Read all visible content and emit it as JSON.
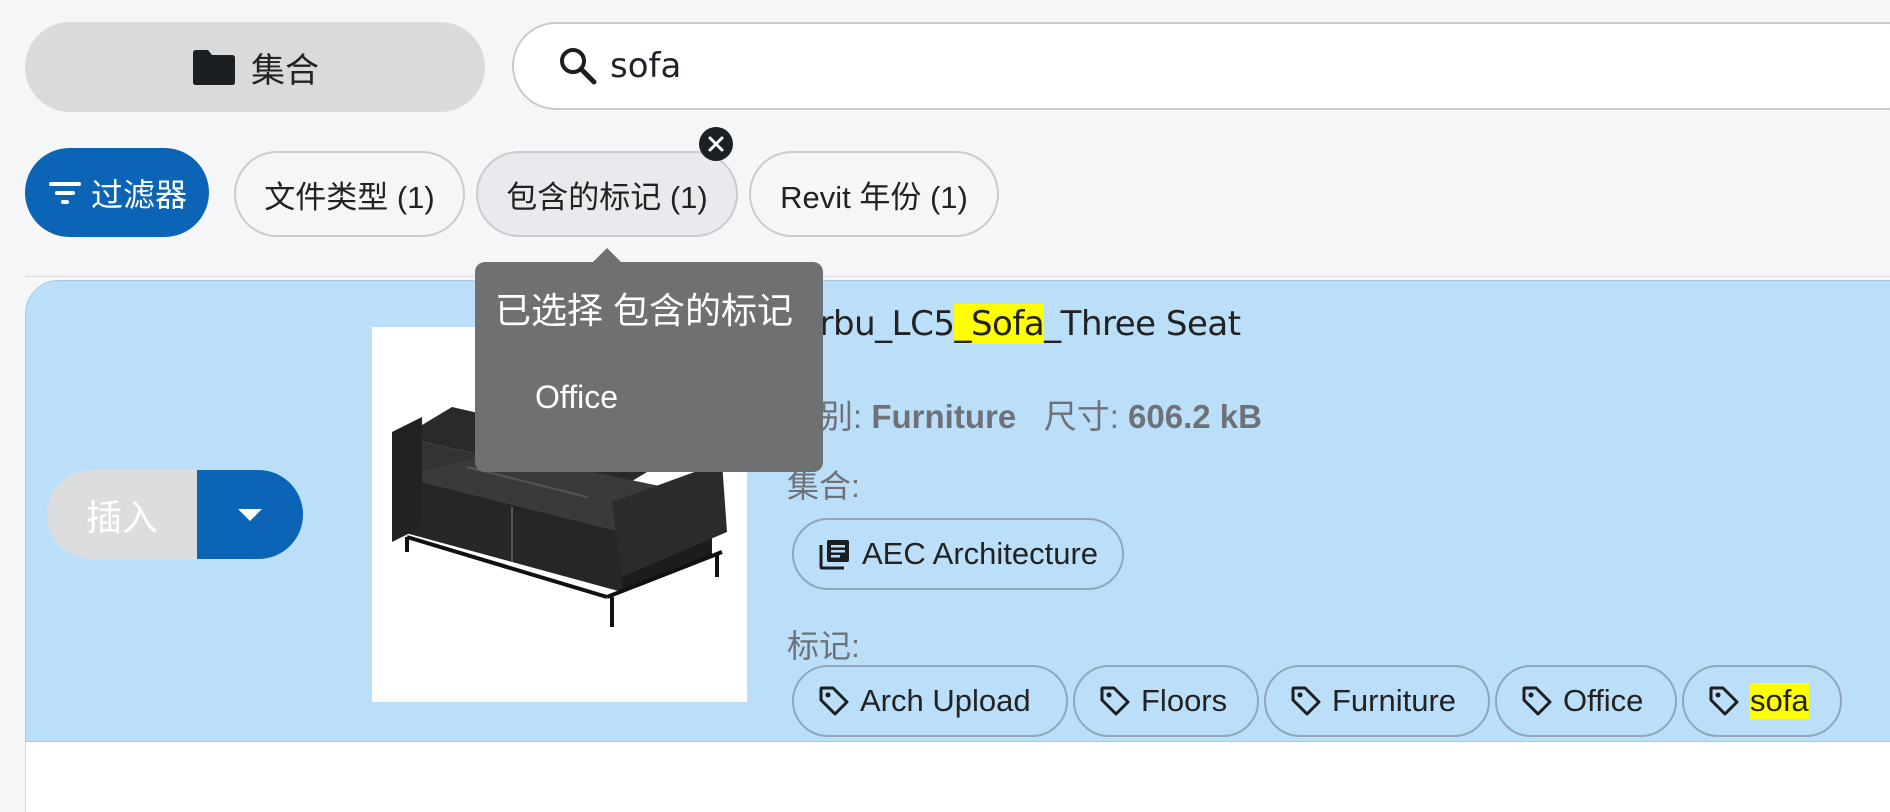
{
  "header": {
    "collection_label": "集合",
    "search_value": "sofa"
  },
  "filters": {
    "filter_label": "过滤器",
    "chips": [
      {
        "label": "文件类型 (1)"
      },
      {
        "label": "包含的标记 (1)"
      },
      {
        "label": "Revit 年份 (1)"
      }
    ]
  },
  "tooltip": {
    "title": "已选择 包含的标记",
    "items": [
      "Office"
    ]
  },
  "result": {
    "insert_label": "插入",
    "title_prefix": "Corbu_LC5",
    "title_highlight": "_Sofa",
    "title_suffix": "_Three Seat",
    "category_label": "类别:",
    "category_value": "Furniture",
    "size_label": "尺寸:",
    "size_value": "606.2 kB",
    "collection_section_label": "集合:",
    "collections": [
      "AEC Architecture"
    ],
    "tags_section_label": "标记:",
    "tags": [
      {
        "label": "Arch Upload",
        "highlight": false
      },
      {
        "label": "Floors",
        "highlight": false
      },
      {
        "label": "Furniture",
        "highlight": false
      },
      {
        "label": "Office",
        "highlight": false
      },
      {
        "label": "sofa",
        "highlight": true
      }
    ]
  },
  "colors": {
    "primary": "#0b64b5",
    "card_bg": "#bcdff9",
    "highlight": "#ffff00",
    "tooltip_bg": "#6f7072"
  }
}
